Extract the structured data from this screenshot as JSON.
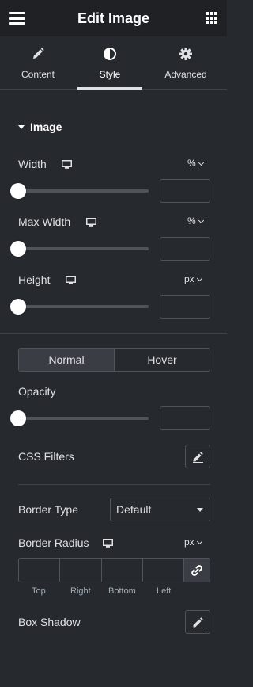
{
  "header": {
    "title": "Edit Image",
    "menu_icon": "hamburger-icon",
    "apps_icon": "grid-icon"
  },
  "tabs": [
    {
      "label": "Content",
      "icon": "pencil-icon",
      "active": false
    },
    {
      "label": "Style",
      "icon": "contrast-icon",
      "active": true
    },
    {
      "label": "Advanced",
      "icon": "gear-icon",
      "active": false
    }
  ],
  "section": {
    "title": "Image"
  },
  "controls": {
    "width": {
      "label": "Width",
      "unit": "%",
      "value": ""
    },
    "max_width": {
      "label": "Max Width",
      "unit": "%",
      "value": ""
    },
    "height": {
      "label": "Height",
      "unit": "px",
      "value": ""
    }
  },
  "state_toggle": {
    "normal": "Normal",
    "hover": "Hover",
    "active": "Normal"
  },
  "opacity": {
    "label": "Opacity",
    "value": ""
  },
  "css_filters": {
    "label": "CSS Filters"
  },
  "border_type": {
    "label": "Border Type",
    "selected": "Default"
  },
  "border_radius": {
    "label": "Border Radius",
    "unit": "px",
    "sides": [
      "Top",
      "Right",
      "Bottom",
      "Left"
    ]
  },
  "box_shadow": {
    "label": "Box Shadow"
  },
  "colors": {
    "panel": "#26292d",
    "header": "#1f2124",
    "text": "#e0e1e3",
    "border": "#505359"
  }
}
